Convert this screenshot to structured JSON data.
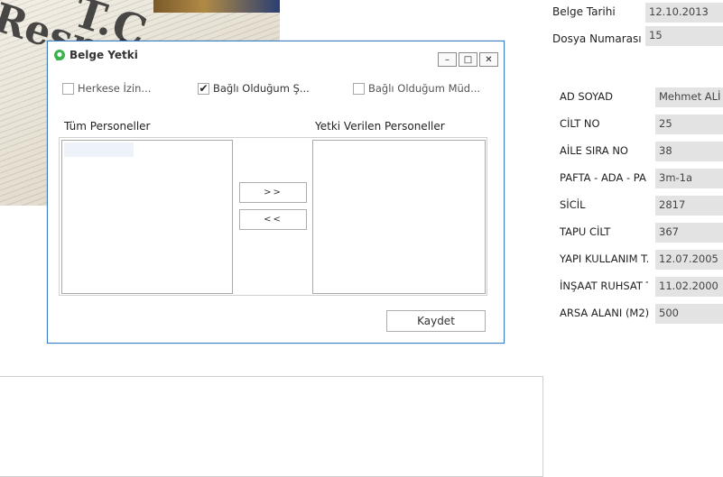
{
  "background": {
    "newspaper_text_1": "Resmî",
    "newspaper_text_2": "T.C."
  },
  "top_fields": [
    {
      "label": "Belge Tarihi",
      "value": "12.10.2013"
    },
    {
      "label": "Dosya Numarası",
      "value": "15"
    }
  ],
  "details": [
    {
      "label": "AD SOYAD",
      "value": "Mehmet ALİ"
    },
    {
      "label": "CİLT NO",
      "value": "25"
    },
    {
      "label": "AİLE SIRA NO",
      "value": "38"
    },
    {
      "label": "PAFTA - ADA - PA",
      "value": "3m-1a"
    },
    {
      "label": "SİCİL",
      "value": "2817"
    },
    {
      "label": "TAPU CİLT",
      "value": "367"
    },
    {
      "label": "YAPI KULLANIM T.",
      "value": "12.07.2005"
    },
    {
      "label": "İNŞAAT RUHSAT T.",
      "value": "11.02.2000"
    },
    {
      "label": "ARSA  ALANI (M2)",
      "value": "500"
    }
  ],
  "dialog": {
    "title": "Belge Yetki",
    "window_buttons": {
      "minimize": "–",
      "maximize": "□",
      "close": "✕"
    },
    "checkboxes": [
      {
        "label": "Herkese  İzin...",
        "checked": false
      },
      {
        "label": "Bağlı Olduğum Ş...",
        "checked": true
      },
      {
        "label": "Bağlı Olduğum Müd...",
        "checked": false
      }
    ],
    "left_list_label": "Tüm Personeller",
    "right_list_label": "Yetki Verilen Personeller",
    "add_button": ">>",
    "remove_button": "<<",
    "save_button": "Kaydet",
    "accent_color": "#3c7fc4",
    "icon_color": "#3bb34a"
  }
}
